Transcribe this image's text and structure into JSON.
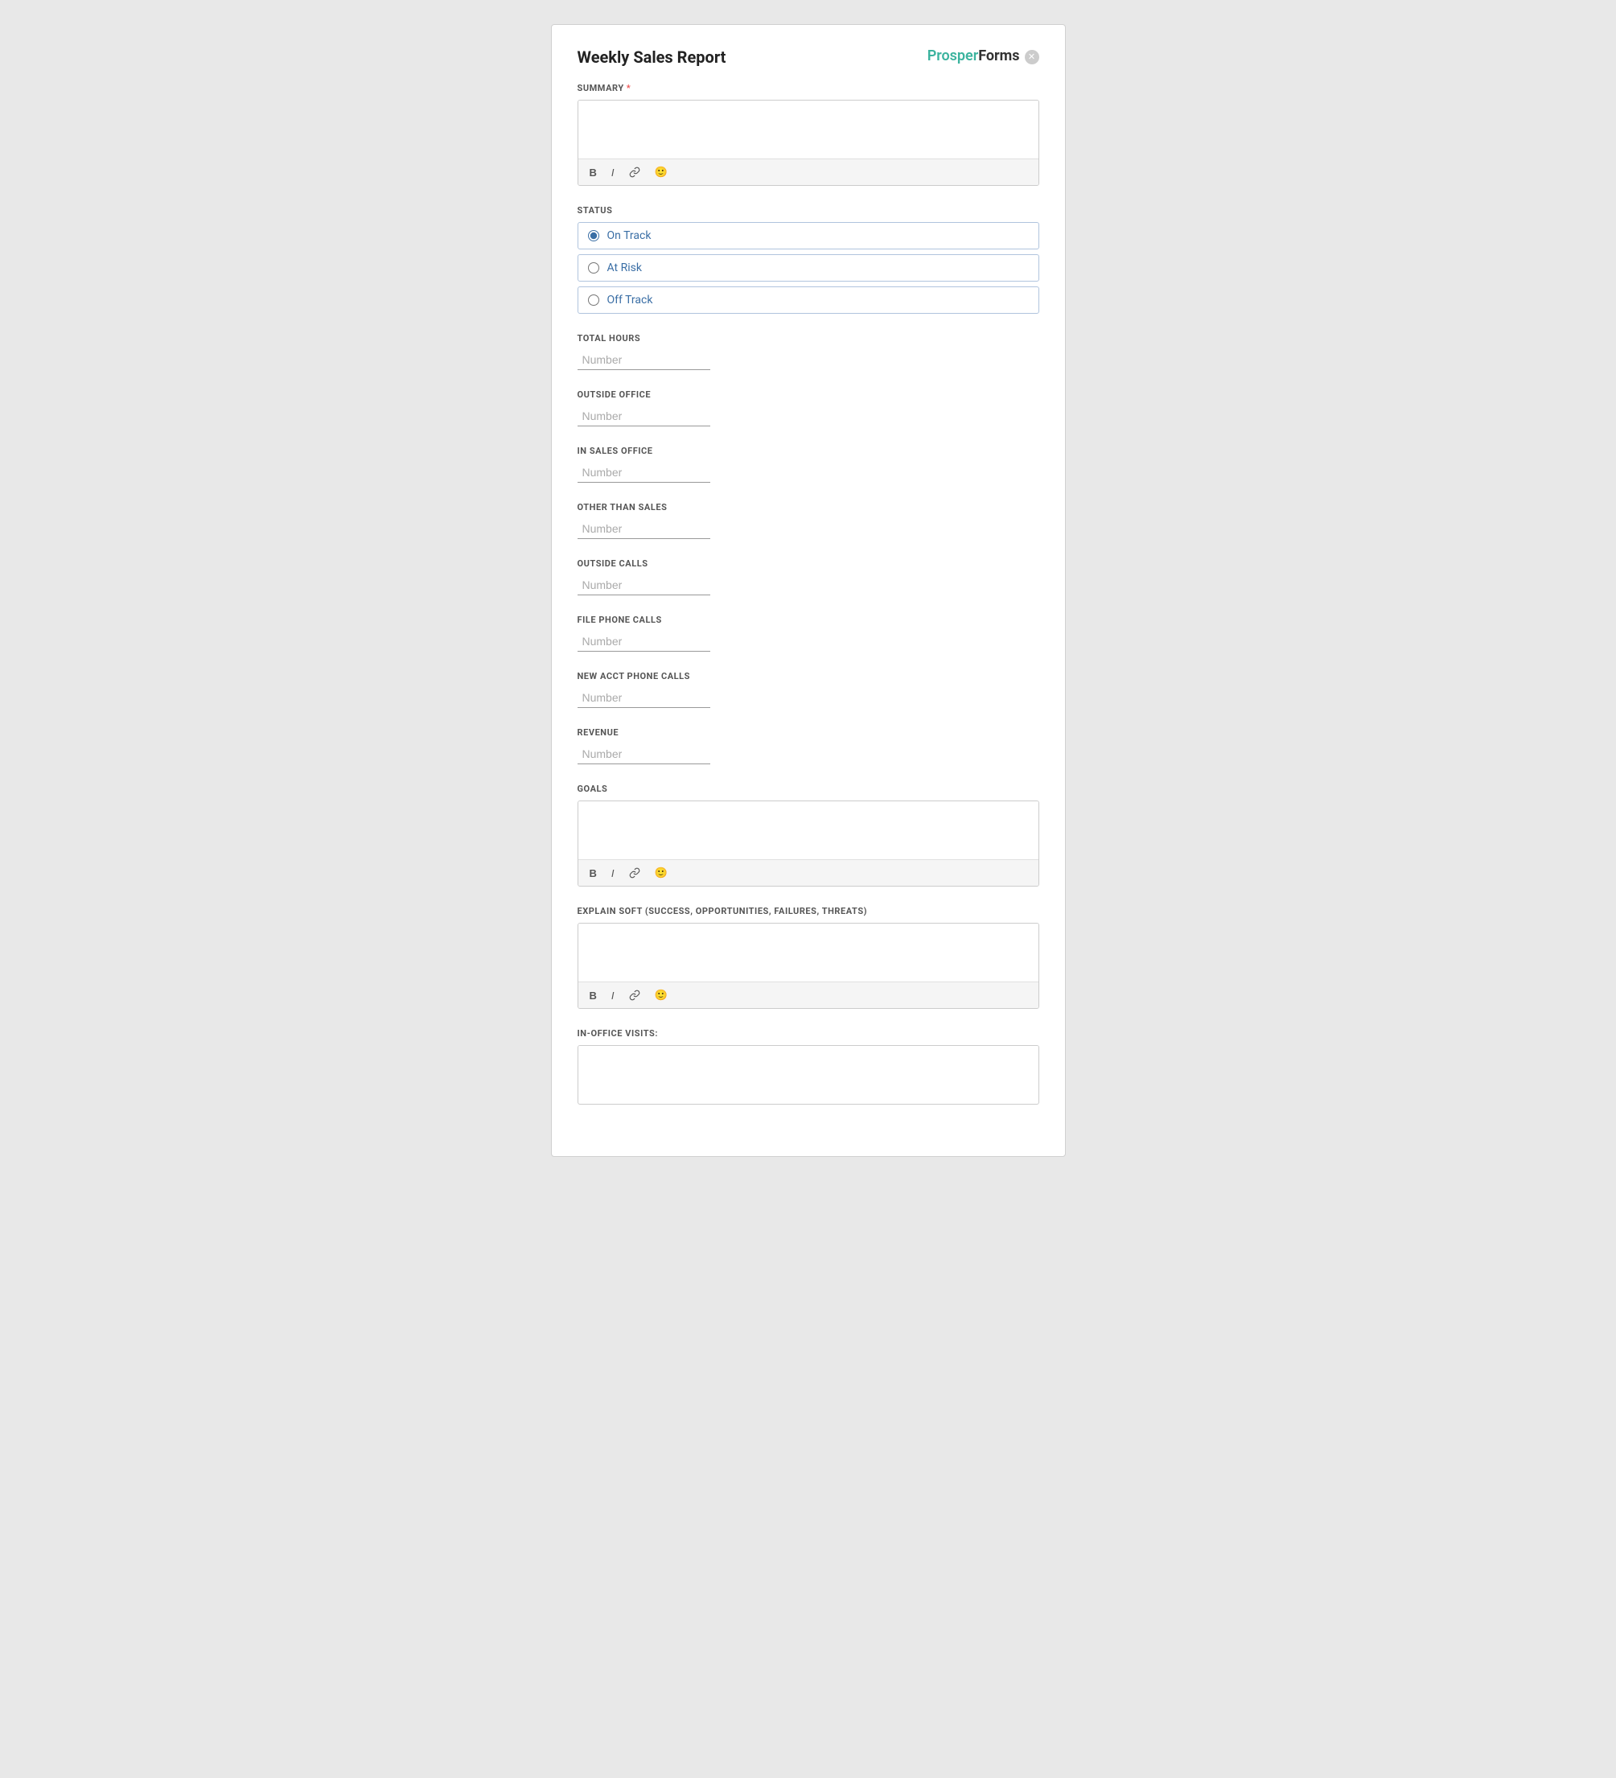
{
  "header": {
    "title": "Weekly Sales Report",
    "brand_prosper": "Prosper",
    "brand_forms": "Forms"
  },
  "sections": {
    "summary": {
      "label": "SUMMARY",
      "required": true,
      "placeholder": ""
    },
    "status": {
      "label": "STATUS",
      "options": [
        {
          "id": "on-track",
          "label": "On Track",
          "checked": true
        },
        {
          "id": "at-risk",
          "label": "At Risk",
          "checked": false
        },
        {
          "id": "off-track",
          "label": "Off Track",
          "checked": false
        }
      ]
    },
    "total_hours": {
      "label": "TOTAL HOURS",
      "placeholder": "Number"
    },
    "outside_office": {
      "label": "OUTSIDE OFFICE",
      "placeholder": "Number"
    },
    "in_sales_office": {
      "label": "IN SALES OFFICE",
      "placeholder": "Number"
    },
    "other_than_sales": {
      "label": "OTHER THAN SALES",
      "placeholder": "Number"
    },
    "outside_calls": {
      "label": "OUTSIDE CALLS",
      "placeholder": "Number"
    },
    "file_phone_calls": {
      "label": "FILE PHONE CALLS",
      "placeholder": "Number"
    },
    "new_acct_phone_calls": {
      "label": "NEW ACCT PHONE CALLS",
      "placeholder": "Number"
    },
    "revenue": {
      "label": "REVENUE",
      "placeholder": "Number"
    },
    "goals": {
      "label": "GOALS",
      "placeholder": ""
    },
    "explain_soft": {
      "label": "EXPLAIN SOFT (SUCCESS, OPPORTUNITIES, FAILURES, THREATS)",
      "placeholder": ""
    },
    "in_office_visits": {
      "label": "IN-OFFICE VISITS:",
      "placeholder": ""
    }
  },
  "toolbar": {
    "bold": "B",
    "italic": "I",
    "link": "🔗",
    "emoji": "🙂"
  }
}
